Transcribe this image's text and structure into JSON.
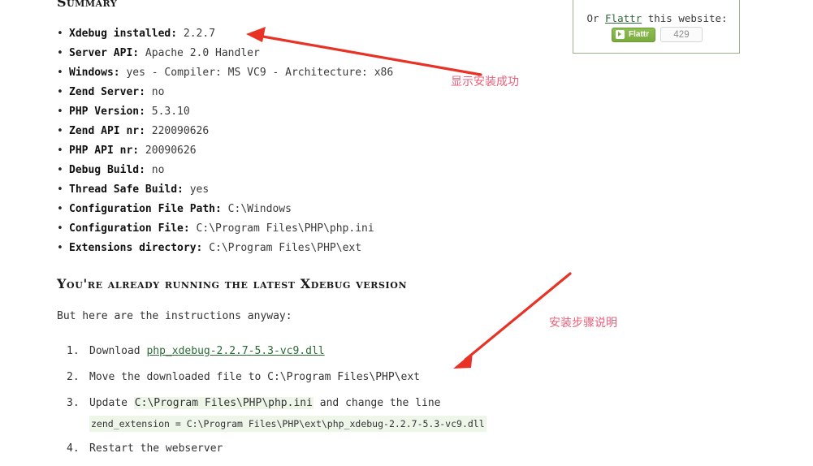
{
  "page": {
    "summary_heading": "Summary",
    "sub_heading": "You're already running the latest Xdebug version",
    "intro_text": "But here are the instructions anyway:"
  },
  "summary": {
    "items": [
      {
        "key": "Xdebug installed:",
        "value": "2.2.7"
      },
      {
        "key": "Server API:",
        "value": "Apache 2.0 Handler"
      },
      {
        "key": "Windows:",
        "value": "yes - Compiler: MS VC9 - Architecture: x86"
      },
      {
        "key": "Zend Server:",
        "value": "no"
      },
      {
        "key": "PHP Version:",
        "value": "5.3.10"
      },
      {
        "key": "Zend API nr:",
        "value": "220090626"
      },
      {
        "key": "PHP API nr:",
        "value": "20090626"
      },
      {
        "key": "Debug Build:",
        "value": "no"
      },
      {
        "key": "Thread Safe Build:",
        "value": "yes"
      },
      {
        "key": "Configuration File Path:",
        "value": "C:\\Windows"
      },
      {
        "key": "Configuration File:",
        "value": "C:\\Program Files\\PHP\\php.ini"
      },
      {
        "key": "Extensions directory:",
        "value": "C:\\Program Files\\PHP\\ext"
      }
    ]
  },
  "steps": {
    "step1_prefix": "Download ",
    "step1_link": "php_xdebug-2.2.7-5.3-vc9.dll",
    "step2": "Move the downloaded file to C:\\Program Files\\PHP\\ext",
    "step3_prefix": "Update ",
    "step3_code": "C:\\Program Files\\PHP\\php.ini",
    "step3_suffix": " and change the line",
    "step3_codeline": "zend_extension = C:\\Program Files\\PHP\\ext\\php_xdebug-2.2.7-5.3-vc9.dll",
    "step4": "Restart the webserver"
  },
  "flattr": {
    "text_before": "Or ",
    "link": "Flattr",
    "text_after": " this website:",
    "button_label": "Flattr",
    "count": "429"
  },
  "annotations": {
    "note1": "显示安装成功",
    "note2": "安装步骤说明",
    "color": "#e8607a",
    "arrow_color": "#e83226"
  }
}
